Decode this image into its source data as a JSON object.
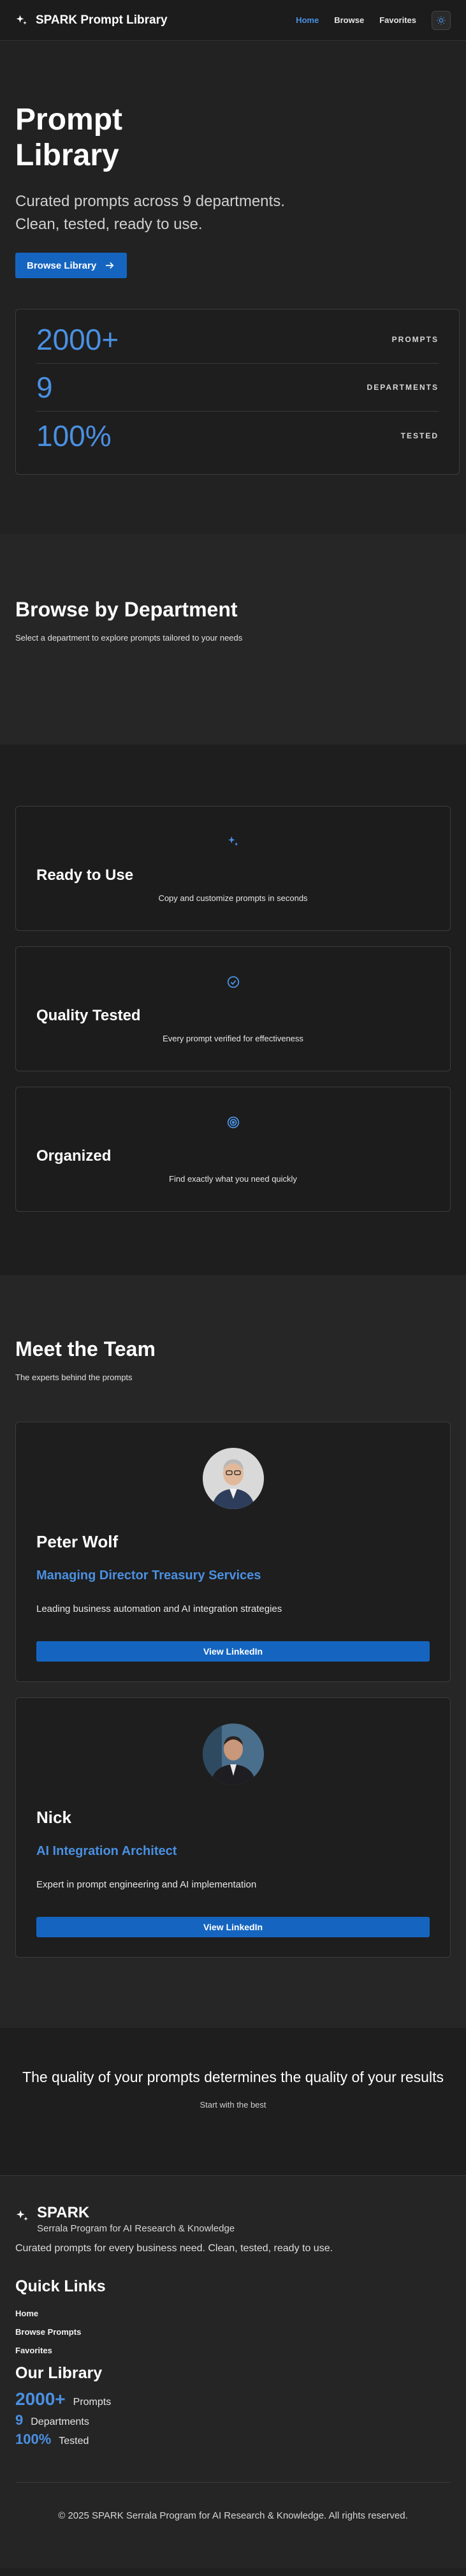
{
  "nav": {
    "brand": "SPARK Prompt Library",
    "links": [
      "Home",
      "Browse",
      "Favorites"
    ],
    "active": "Home"
  },
  "hero": {
    "title": "Prompt Library",
    "subtitle": "Curated prompts across 9 departments. Clean, tested, ready to use.",
    "button": "Browse Library",
    "stats": [
      {
        "value": "2000+",
        "label": "PROMPTS"
      },
      {
        "value": "9",
        "label": "DEPARTMENTS"
      },
      {
        "value": "100%",
        "label": "TESTED"
      }
    ]
  },
  "departments": {
    "title": "Browse by Department",
    "subtitle": "Select a department to explore prompts tailored to your needs"
  },
  "features": [
    {
      "icon": "sparkles-icon",
      "title": "Ready to Use",
      "desc": "Copy and customize prompts in seconds"
    },
    {
      "icon": "check-circle-icon",
      "title": "Quality Tested",
      "desc": "Every prompt verified for effectiveness"
    },
    {
      "icon": "target-icon",
      "title": "Organized",
      "desc": "Find exactly what you need quickly"
    }
  ],
  "team": {
    "title": "Meet the Team",
    "subtitle": "The experts behind the prompts",
    "members": [
      {
        "name": "Peter Wolf",
        "role": "Managing Director Treasury Services",
        "desc": "Leading business automation and AI integration strategies",
        "button": "View LinkedIn"
      },
      {
        "name": "Nick",
        "role": "AI Integration Architect",
        "desc": "Expert in prompt engineering and AI implementation",
        "button": "View LinkedIn"
      }
    ]
  },
  "quote": {
    "text": "The quality of your prompts determines the quality of your results",
    "sub": "Start with the best"
  },
  "footer": {
    "name": "SPARK",
    "sub": "Serrala Program for AI Research & Knowledge",
    "tagline": "Curated prompts for every business need. Clean, tested, ready to use.",
    "quick_links_title": "Quick Links",
    "quick_links": [
      "Home",
      "Browse Prompts",
      "Favorites"
    ],
    "library_title": "Our Library",
    "library": [
      {
        "value": "2000+",
        "label": "Prompts"
      },
      {
        "value": "9",
        "label": "Departments"
      },
      {
        "value": "100%",
        "label": "Tested"
      }
    ],
    "copyright": "© 2025 SPARK Serrala Program for AI Research & Knowledge. All rights reserved."
  },
  "colors": {
    "accent": "#4a90e2",
    "button": "#1565c0",
    "background": "#1f1f1f"
  }
}
